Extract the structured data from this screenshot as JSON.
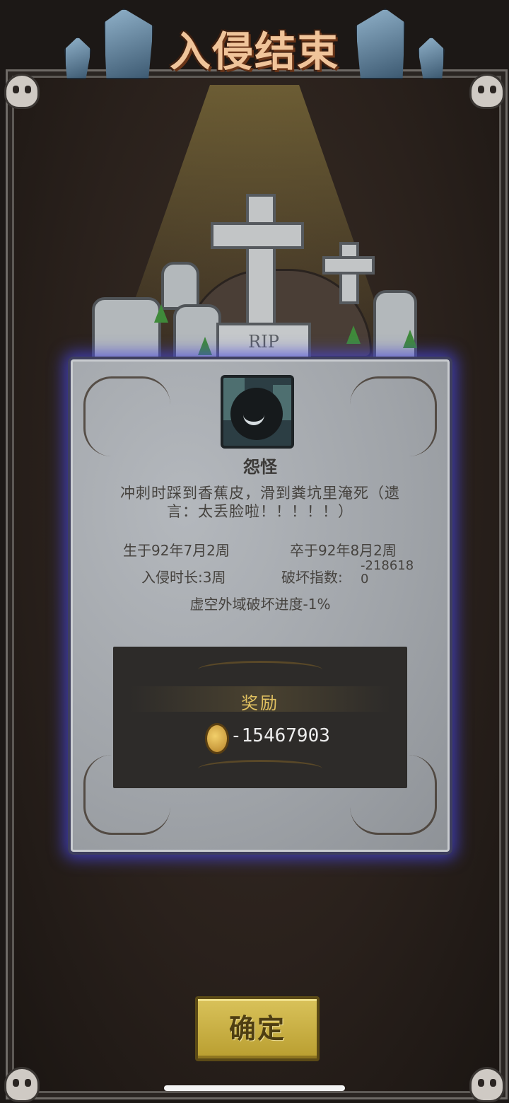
{
  "title": "入侵结束",
  "grave": {
    "epitaph": "RIP"
  },
  "card": {
    "portrait_icon": "one-eyed-shadow-monster",
    "name": "怨怪",
    "description": "冲刺时踩到香蕉皮，滑到粪坑里淹死（遗言：太丢脸啦！！！！！）",
    "born": "生于92年7月2周",
    "died": "卒于92年8月2周",
    "duration": "入侵时长:3周",
    "damage_label": "破坏指数:",
    "damage_value": "-2186180",
    "progress": "虚空外域破坏进度-1%"
  },
  "reward": {
    "label": "奖励",
    "icon": "coin-icon",
    "value": "-15467903"
  },
  "confirm_label": "确定",
  "colors": {
    "title": "#f0c49a",
    "card_glow": "#4646dc",
    "reward_label": "#e0c060",
    "button": "#d9c25a"
  }
}
